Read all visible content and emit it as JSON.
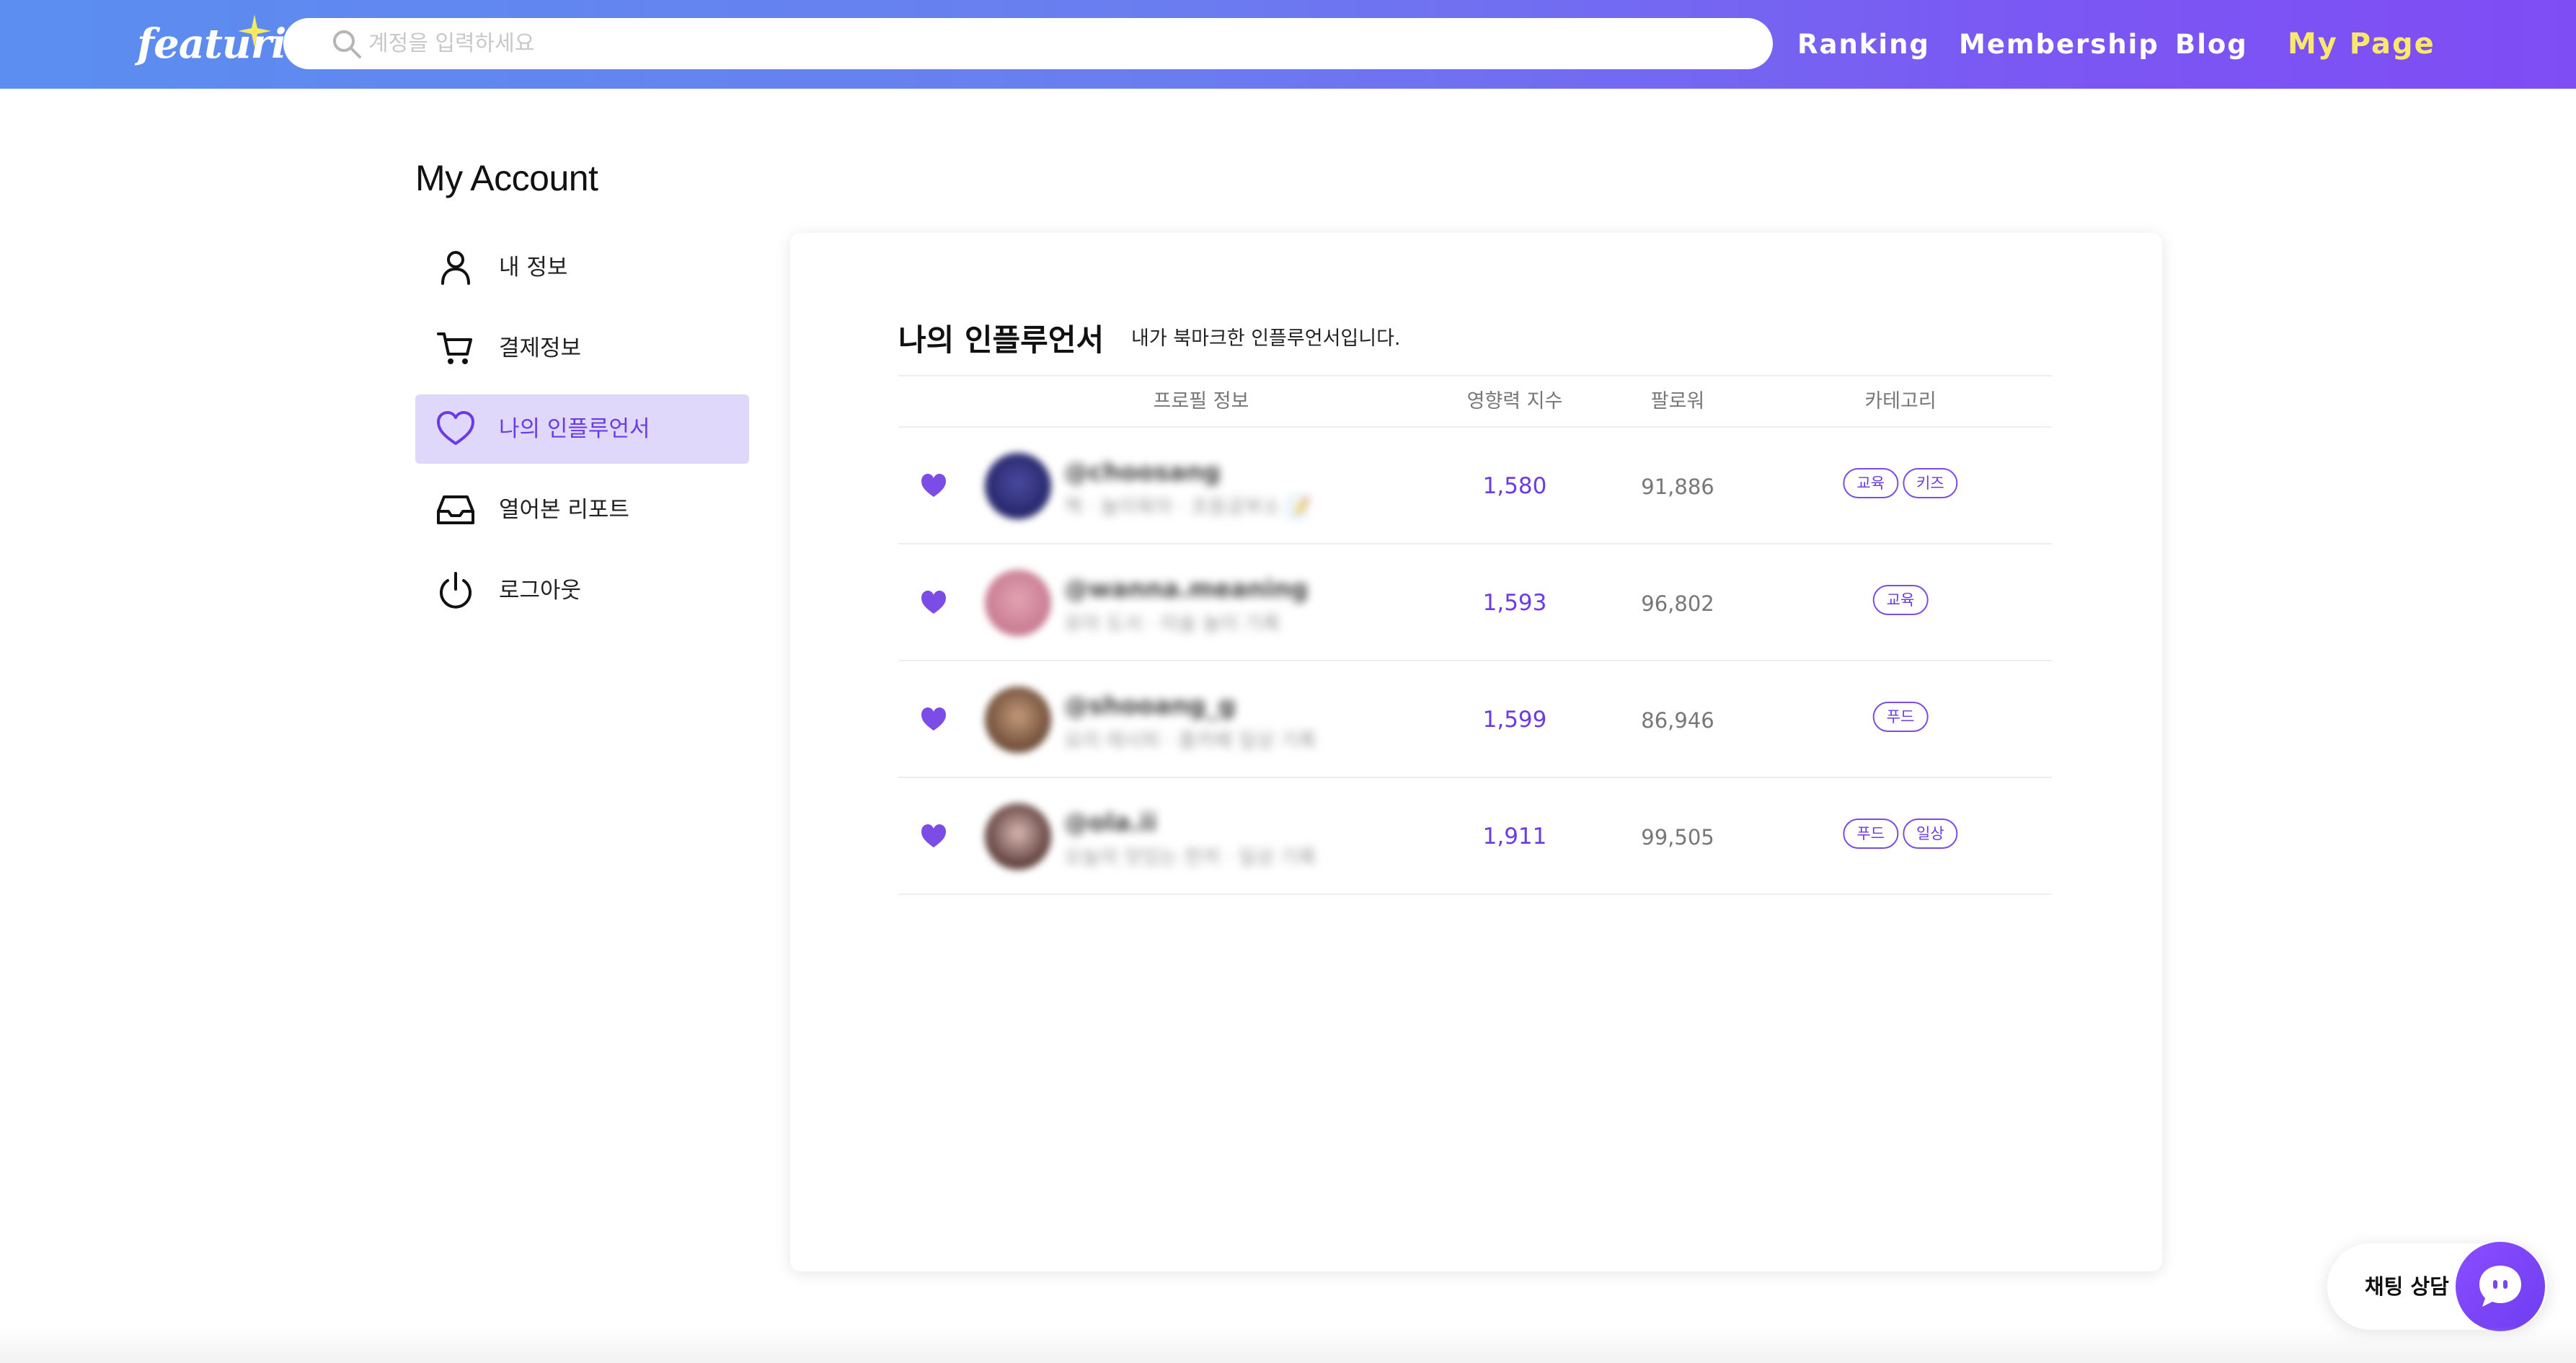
{
  "header": {
    "logo_text": "featuring",
    "search_placeholder": "계정을 입력하세요",
    "nav": [
      {
        "label": "Ranking"
      },
      {
        "label": "Membership"
      },
      {
        "label": "Blog"
      },
      {
        "label": "My Page",
        "active": true
      }
    ]
  },
  "sidebar": {
    "title": "My Account",
    "items": [
      {
        "label": "내 정보",
        "icon": "person-icon"
      },
      {
        "label": "결제정보",
        "icon": "cart-icon"
      },
      {
        "label": "나의 인플루언서",
        "icon": "heart-outline-icon",
        "selected": true
      },
      {
        "label": "열어본 리포트",
        "icon": "inbox-icon"
      },
      {
        "label": "로그아웃",
        "icon": "power-icon"
      }
    ]
  },
  "main": {
    "title": "나의 인플루언서",
    "subtitle": "내가 북마크한 인플루언서입니다.",
    "columns": [
      "프로필 정보",
      "영향력 지수",
      "팔로워",
      "카테고리"
    ],
    "rows": [
      {
        "handle": "@choosang",
        "bio": "책 · 놀이육아 · 초등공부소 📝",
        "score": "1,580",
        "followers": "91,886",
        "tags": [
          "교육",
          "키즈"
        ]
      },
      {
        "handle": "@wanna.meaning",
        "bio": "유아 도서 · 미술 놀이 기록",
        "score": "1,593",
        "followers": "96,802",
        "tags": [
          "교육"
        ]
      },
      {
        "handle": "@shooang_g",
        "bio": "요리 레시피 · 홈카페 일상 기록",
        "score": "1,599",
        "followers": "86,946",
        "tags": [
          "푸드"
        ]
      },
      {
        "handle": "@ola.ii",
        "bio": "오늘의 맛있는 한끼 · 일상 기록",
        "score": "1,911",
        "followers": "99,505",
        "tags": [
          "푸드",
          "일상"
        ]
      }
    ]
  },
  "chat": {
    "label": "채팅 상담"
  },
  "colors": {
    "accent": "#6b3ce6",
    "nav_active": "#f9e96a",
    "selected_bg": "#e0d8fb"
  }
}
